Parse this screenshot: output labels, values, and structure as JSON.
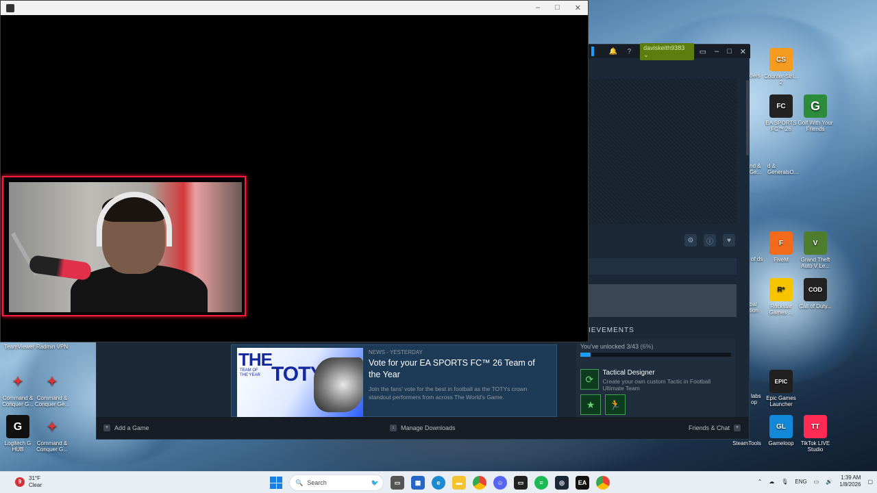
{
  "desktop": {
    "left_icons": [
      {
        "label": "TeamViewer",
        "color": "#0e6bd8"
      },
      {
        "label": "Radmin VPN",
        "color": "#1f4f86"
      },
      {
        "label": "Command & Conquer G...",
        "color": "#b8322b"
      },
      {
        "label": "Command & Conquer Ge...",
        "color": "#b8322b"
      },
      {
        "label": "Logitech G HUB",
        "color": "#111111"
      },
      {
        "label": "Command & Conquer G...",
        "color": "#b8322b"
      }
    ],
    "right_icons": [
      {
        "label": "Counter-Stri... 2",
        "icon": "CS",
        "color": "#f59b20"
      },
      {
        "label": "EA SPORTS FC™ 26",
        "icon": "FC",
        "color": "#222222"
      },
      {
        "label": "Golf With Your Friends",
        "icon": "G",
        "color": "#2c8c3c"
      },
      {
        "label": "FiveM",
        "icon": "F",
        "color": "#f26a1b"
      },
      {
        "label": "Grand Theft Auto V Le...",
        "icon": "V",
        "color": "#4f7d2e"
      },
      {
        "label": "Rockstar Games ...",
        "icon": "R*",
        "color": "#f7c400"
      },
      {
        "label": "Call of Duty...",
        "icon": "COD",
        "color": "#222222"
      },
      {
        "label": "Epic Games Launcher",
        "icon": "EPIC",
        "color": "#202020"
      },
      {
        "label": "SteamTools",
        "icon": "ST",
        "color": "#1a9fff"
      },
      {
        "label": "Gameloop",
        "icon": "GL",
        "color": "#1488d8"
      },
      {
        "label": "TikTok LIVE Studio",
        "icon": "TT",
        "color": "#fe2c55"
      }
    ],
    "partial_labels": [
      "ders",
      "nd & Ge...",
      "d & GeneralsO...",
      "of ds",
      "bal tion",
      "labs op"
    ]
  },
  "steam": {
    "username": "daviskeith9383",
    "help_icon": "?",
    "achievements_header": "IEVEMENTS",
    "achievements_progress": "You've unlocked 3/43",
    "achievements_pct": "(6%)",
    "achievements_fraction": 0.07,
    "achievement": {
      "name": "Tactical Designer",
      "desc": "Create your own custom Tactic in Football Ultimate Team"
    },
    "news": {
      "meta": "NEWS - YESTERDAY",
      "title": "Vote for your EA SPORTS FC™ 26 Team of the Year",
      "desc": "Join the fans' vote for the best in football as the TOTYs crown standout performers from across The World's Game.",
      "img_line1": "THE",
      "img_line2": "TEAM OF THE YEAR",
      "img_line3": "TOTYS"
    },
    "footer": {
      "add_game": "Add a Game",
      "manage_downloads": "Manage Downloads",
      "friends_chat": "Friends & Chat"
    }
  },
  "taskbar": {
    "weather_temp": "31°F",
    "weather_cond": "Clear",
    "weather_badge": "9",
    "search_placeholder": "Search",
    "lang": "ENG",
    "time": "1:39 AM",
    "date": "1/8/2026"
  }
}
